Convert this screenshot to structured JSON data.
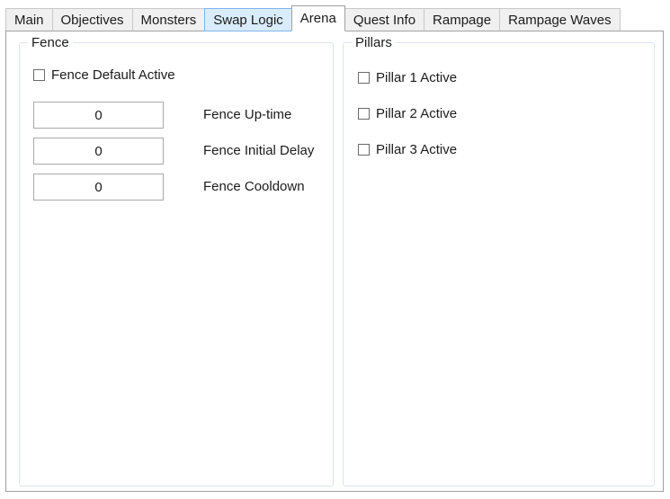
{
  "tabs": [
    {
      "label": "Main",
      "state": "normal"
    },
    {
      "label": "Objectives",
      "state": "normal"
    },
    {
      "label": "Monsters",
      "state": "normal"
    },
    {
      "label": "Swap Logic",
      "state": "hover"
    },
    {
      "label": "Arena",
      "state": "selected"
    },
    {
      "label": "Quest Info",
      "state": "normal"
    },
    {
      "label": "Rampage",
      "state": "normal"
    },
    {
      "label": "Rampage Waves",
      "state": "normal"
    }
  ],
  "fence": {
    "title": "Fence",
    "default_active": {
      "label": "Fence Default Active",
      "checked": false
    },
    "fields": [
      {
        "label": "Fence Up-time",
        "value": "0"
      },
      {
        "label": "Fence Initial Delay",
        "value": "0"
      },
      {
        "label": "Fence Cooldown",
        "value": "0"
      }
    ]
  },
  "pillars": {
    "title": "Pillars",
    "items": [
      {
        "label": "Pillar 1 Active",
        "checked": false
      },
      {
        "label": "Pillar 2 Active",
        "checked": false
      },
      {
        "label": "Pillar 3 Active",
        "checked": false
      }
    ]
  },
  "colors": {
    "tab_normal_bg": "#f0f0f0",
    "tab_hover_bg": "#d9ecfb",
    "tab_hover_border": "#7eb4e8",
    "panel_border": "#a0a0a0",
    "group_border": "#dbe4ed",
    "input_border": "#a9a9a9",
    "text": "#1b1b1b"
  }
}
